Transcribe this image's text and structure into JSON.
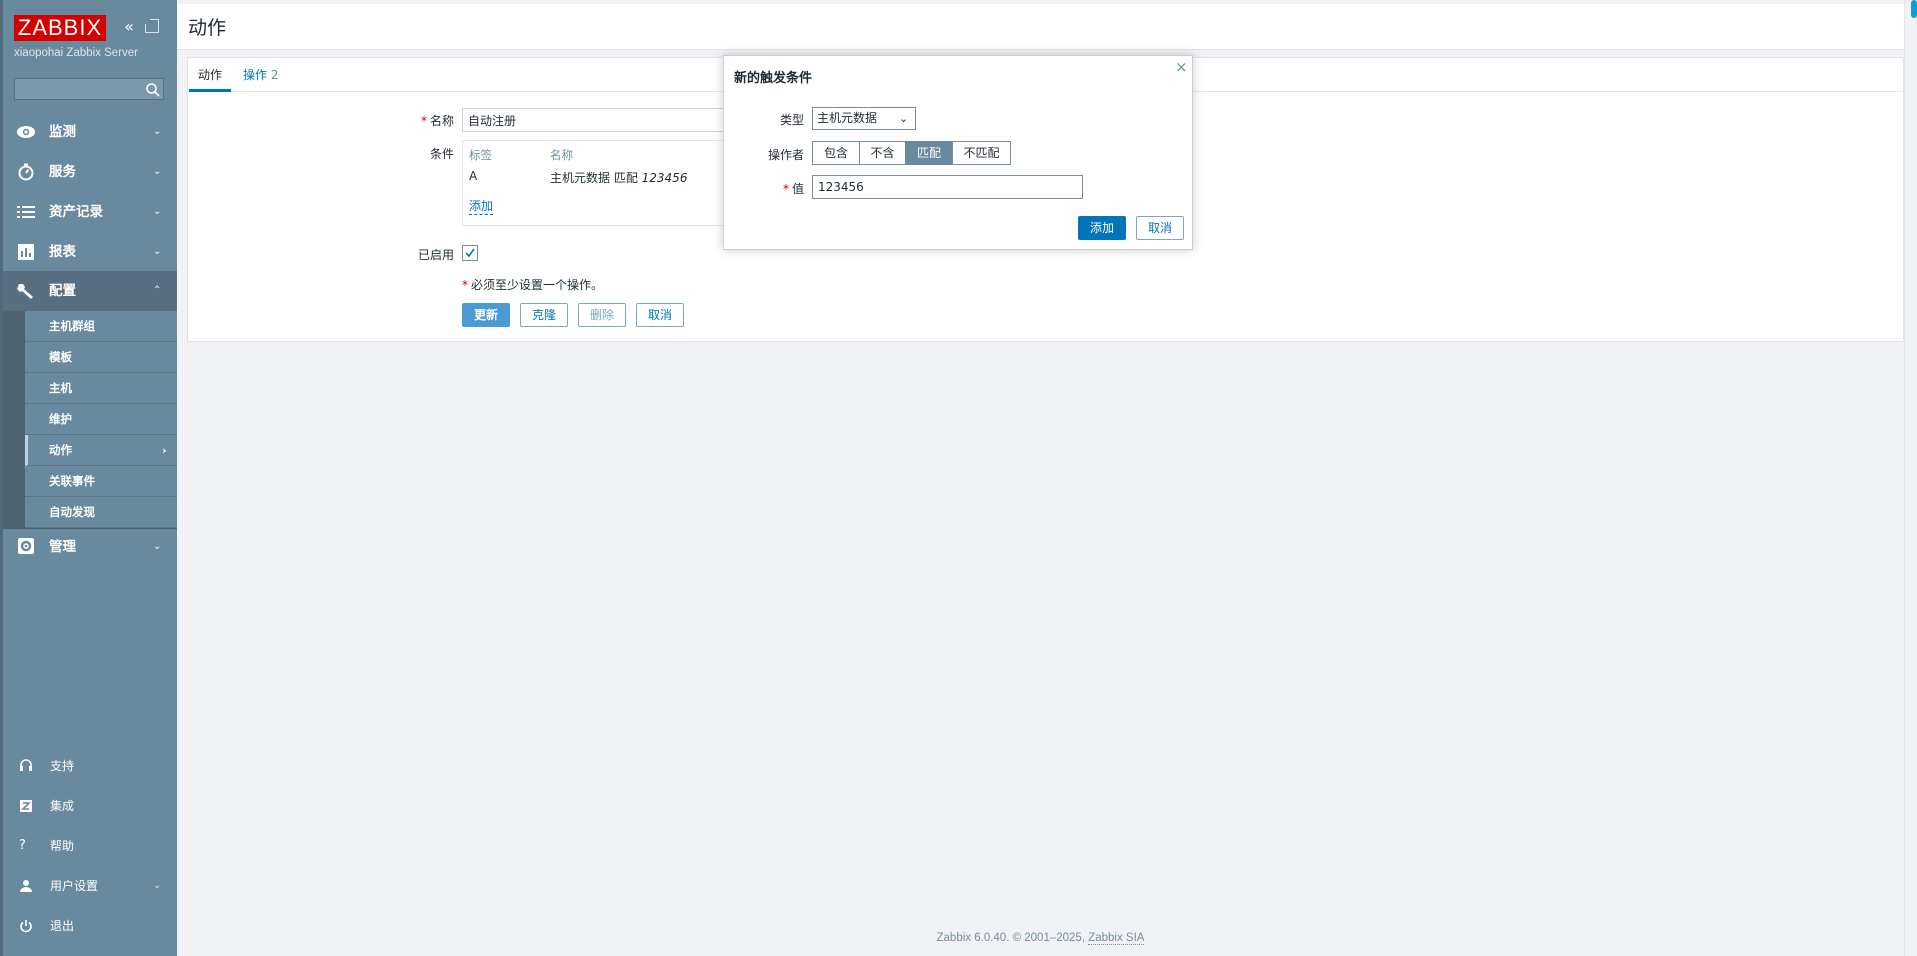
{
  "sidebar": {
    "logo": "ZABBIX",
    "server_name": "xiaopohai Zabbix Server",
    "search": {
      "value": "",
      "placeholder": ""
    },
    "menu": [
      {
        "label": "监测",
        "icon": "eye-icon"
      },
      {
        "label": "服务",
        "icon": "stopwatch-icon"
      },
      {
        "label": "资产记录",
        "icon": "list-icon"
      },
      {
        "label": "报表",
        "icon": "bar-chart-icon"
      },
      {
        "label": "配置",
        "icon": "wrench-icon"
      },
      {
        "label": "管理",
        "icon": "gear-icon"
      }
    ],
    "submenu": [
      {
        "label": "主机群组"
      },
      {
        "label": "模板"
      },
      {
        "label": "主机"
      },
      {
        "label": "维护"
      },
      {
        "label": "动作"
      },
      {
        "label": "关联事件"
      },
      {
        "label": "自动发现"
      }
    ],
    "bottom": [
      {
        "label": "支持",
        "icon": "headset-icon"
      },
      {
        "label": "集成",
        "icon": "integrations-icon"
      },
      {
        "label": "帮助",
        "icon": "help-icon"
      },
      {
        "label": "用户设置",
        "icon": "user-icon"
      },
      {
        "label": "退出",
        "icon": "power-icon"
      }
    ]
  },
  "header": {
    "title": "动作"
  },
  "tabs": [
    {
      "label": "动作"
    },
    {
      "label": "操作",
      "badge": "2"
    }
  ],
  "form": {
    "name_label": "名称",
    "name_value": "自动注册",
    "conditions_label": "条件",
    "conditions_columns": [
      "标签",
      "名称"
    ],
    "conditions_rows": [
      {
        "tag": "A",
        "name": "主机元数据 匹配 ",
        "value": "123456"
      }
    ],
    "add_link": "添加",
    "enabled_label": "已启用",
    "enabled": true,
    "note": "必须至少设置一个操作。",
    "buttons": {
      "update": "更新",
      "clone": "克隆",
      "delete": "删除",
      "cancel": "取消"
    }
  },
  "dialog": {
    "title": "新的触发条件",
    "type_label": "类型",
    "type_value": "主机元数据",
    "operator_label": "操作者",
    "operators": [
      "包含",
      "不含",
      "匹配",
      "不匹配"
    ],
    "operator_selected": "匹配",
    "value_label": "值",
    "value": "123456",
    "add_button": "添加",
    "cancel_button": "取消"
  },
  "footer": {
    "text": "Zabbix 6.0.40. © 2001–2025, ",
    "link": "Zabbix SIA"
  },
  "colors": {
    "sidebar": "#69899e",
    "brand": "#d40000",
    "accent": "#0275b8"
  }
}
